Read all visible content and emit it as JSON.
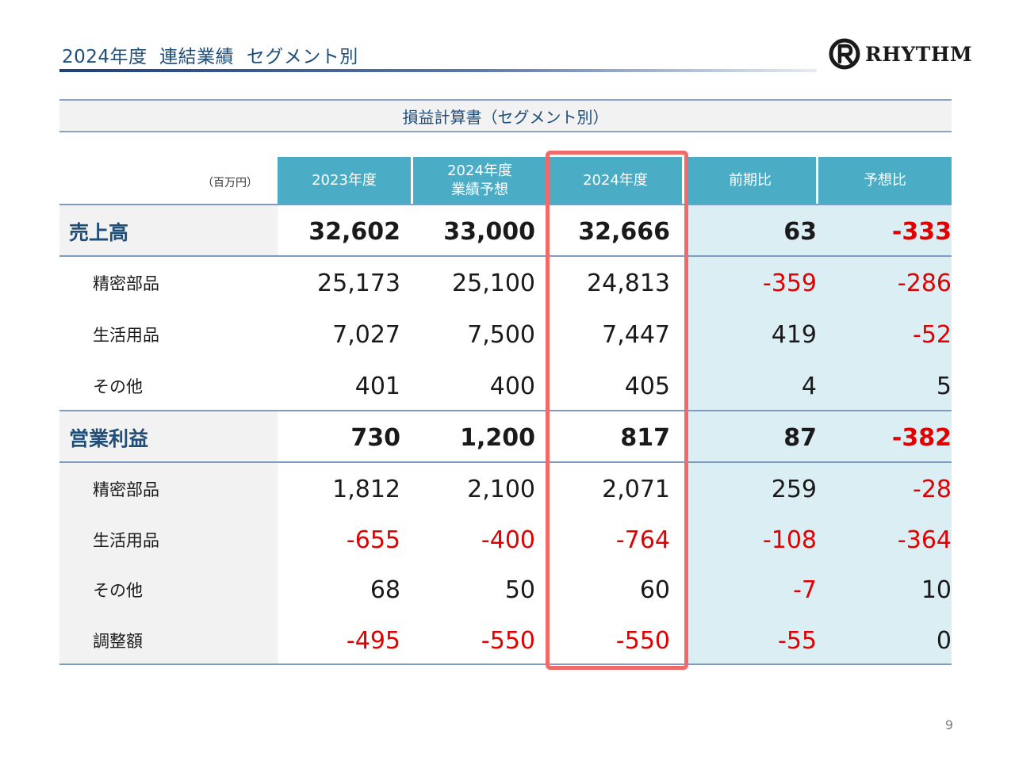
{
  "slide": {
    "title": "2024年度  連結業績  セグメント別",
    "logo_text": "RHYTHM",
    "subheading": "損益計算書（セグメント別）",
    "unit": "（百万円）",
    "page_number": "9",
    "accent_color": "#1f4e79",
    "header_color": "#4bacc6",
    "highlight_color": "#f06a6a",
    "negative_color": "#e00000"
  },
  "table": {
    "columns": [
      "2023年度",
      "2024年度\n業績予想",
      "2024年度",
      "前期比",
      "予想比"
    ],
    "rows": [
      {
        "label": "売上高",
        "values": [
          "32,602",
          "33,000",
          "32,666",
          "63",
          "-333"
        ]
      },
      {
        "label": "精密部品",
        "values": [
          "25,173",
          "25,100",
          "24,813",
          "-359",
          "-286"
        ]
      },
      {
        "label": "生活用品",
        "values": [
          "7,027",
          "7,500",
          "7,447",
          "419",
          "-52"
        ]
      },
      {
        "label": "その他",
        "values": [
          "401",
          "400",
          "405",
          "4",
          "5"
        ]
      },
      {
        "label": "営業利益",
        "values": [
          "730",
          "1,200",
          "817",
          "87",
          "-382"
        ]
      },
      {
        "label": "精密部品",
        "values": [
          "1,812",
          "2,100",
          "2,071",
          "259",
          "-28"
        ]
      },
      {
        "label": "生活用品",
        "values": [
          "-655",
          "-400",
          "-764",
          "-108",
          "-364"
        ]
      },
      {
        "label": "その他",
        "values": [
          "68",
          "50",
          "60",
          "-7",
          "10"
        ]
      },
      {
        "label": "調整額",
        "values": [
          "-495",
          "-550",
          "-550",
          "-55",
          "0"
        ]
      }
    ]
  }
}
